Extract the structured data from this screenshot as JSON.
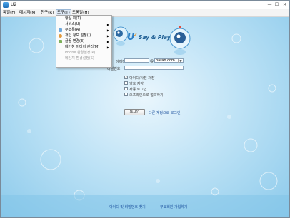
{
  "window": {
    "title": "U2",
    "minimize": "—",
    "maximize": "☐",
    "close": "✕"
  },
  "menubar": {
    "items": [
      "파일(F)",
      "메시지(M)",
      "친구(R)",
      "도구(T)",
      "도움말(H)"
    ]
  },
  "tools_menu": {
    "items": [
      {
        "label": "항상 위(T)",
        "submenu": false,
        "disabled": false
      },
      {
        "label": "서비스(U)",
        "submenu": true,
        "disabled": false
      },
      {
        "label": "주소록(A)",
        "submenu": true,
        "disabled": false
      },
      {
        "label": "개인 정보 설정(I)",
        "submenu": true,
        "disabled": false
      },
      {
        "label": "글꼴 변경(E)",
        "submenu": true,
        "disabled": false
      },
      {
        "label": "메인창 이미지 관리(M)",
        "submenu": true,
        "disabled": false
      },
      {
        "label": "Phone 환경설정(P)",
        "submenu": false,
        "disabled": true
      },
      {
        "label": "메신저 환경설정(S)",
        "submenu": false,
        "disabled": true
      }
    ]
  },
  "logo": {
    "text": "Say & Play"
  },
  "login": {
    "id_label": "아이디",
    "at_sign": "@",
    "domain": "paran.com",
    "password_label": "비밀번호",
    "options": [
      {
        "label": "아이디/사진 저장",
        "checked": true
      },
      {
        "label": "암호 저장",
        "checked": false
      },
      {
        "label": "자동 로그인",
        "checked": false
      },
      {
        "label": "오프라인으로 접속하기",
        "checked": false
      }
    ],
    "login_button": "로그인",
    "other_account_link": "다른 계정으로 로그인"
  },
  "footer": {
    "find_link": "아이디 및 비밀번호 찾기",
    "signup_link": "무료회원 가입하기"
  }
}
